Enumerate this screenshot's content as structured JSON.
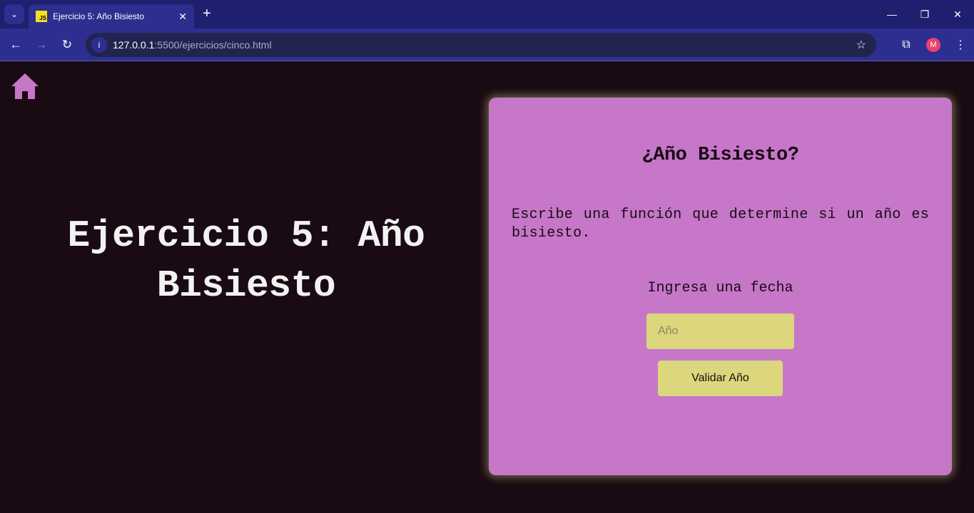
{
  "browser": {
    "tab_title": "Ejercicio 5: Año Bisiesto",
    "favicon_text": "JS",
    "url_host": "127.0.0.1",
    "url_rest": ":5500/ejercicios/cinco.html",
    "profile_initial": "M"
  },
  "page": {
    "heading": "Ejercicio 5: Año Bisiesto",
    "card": {
      "title": "¿Año Bisiesto?",
      "description": "Escribe una función que determine si un año es bisiesto.",
      "label": "Ingresa una fecha",
      "input_placeholder": "Año",
      "input_value": "",
      "button_label": "Validar Año"
    }
  },
  "colors": {
    "background": "#190a13",
    "card": "#c677c8",
    "accent": "#dcd67d",
    "home_icon": "#c677c8"
  }
}
